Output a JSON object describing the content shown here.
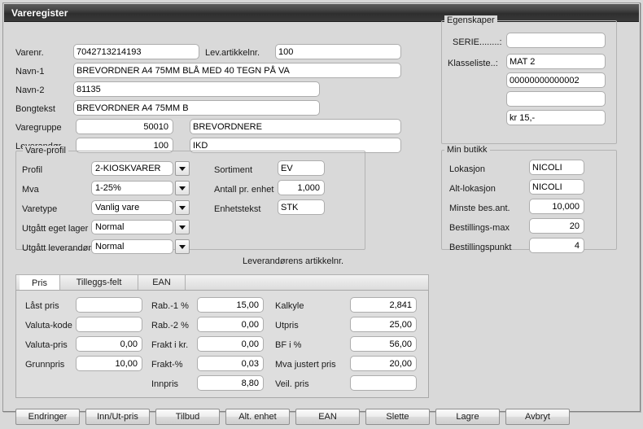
{
  "window": {
    "title": "Vareregister"
  },
  "top_fields": {
    "varenr_label": "Varenr.",
    "varenr_value": "7042713214193",
    "lev_artikkelnr_label": "Lev.artikkelnr.",
    "lev_artikkelnr_value": "100",
    "navn1_label": "Navn-1",
    "navn1_value": "BREVORDNER A4 75MM BLÅ MED 40 TEGN PÅ VA",
    "navn2_label": "Navn-2",
    "navn2_value": "81135",
    "bongtekst_label": "Bongtekst",
    "bongtekst_value": "BREVORDNER A4 75MM B",
    "varegruppe_label": "Varegruppe",
    "varegruppe_code": "50010",
    "varegruppe_name": "BREVORDNERE",
    "leverandor_label": "Leverandør",
    "leverandor_code": "100",
    "leverandor_name": "IKD"
  },
  "vareprofil": {
    "title": "Vare-profil",
    "profil_label": "Profil",
    "profil_value": "2-KIOSKVARER",
    "mva_label": "Mva",
    "mva_value": "1-25%",
    "varetype_label": "Varetype",
    "varetype_value": "Vanlig vare",
    "utgatt_eget_lager_label": "Utgått eget lager",
    "utgatt_eget_lager_value": "Normal",
    "utgatt_leverandor_label": "Utgått leverandør",
    "utgatt_leverandor_value": "Normal",
    "sortiment_label": "Sortiment",
    "sortiment_value": "EV",
    "antall_pr_enhet_label": "Antall pr. enhet",
    "antall_pr_enhet_value": "1,000",
    "enhetstekst_label": "Enhetstekst",
    "enhetstekst_value": "STK"
  },
  "hint": {
    "leverandorens_artikkelnr": "Leverandørens artikkelnr."
  },
  "egenskaper": {
    "title": "Egenskaper",
    "serie_label": "SERIE........:",
    "serie_value": "",
    "klasseliste_label": "Klasseliste..:",
    "klasseliste_values": [
      "MAT 2",
      "00000000000002",
      "",
      "kr 15,-"
    ]
  },
  "min_butikk": {
    "title": "Min butikk",
    "rows": [
      {
        "label": "Lokasjon",
        "value": "NICOLI",
        "align": "left"
      },
      {
        "label": "Alt-lokasjon",
        "value": "NICOLI",
        "align": "left"
      },
      {
        "label": "Minste bes.ant.",
        "value": "10,000",
        "align": "right"
      },
      {
        "label": "Bestillings-max",
        "value": "20",
        "align": "right"
      },
      {
        "label": "Bestillingspunkt",
        "value": "4",
        "align": "right"
      }
    ]
  },
  "tabs": {
    "items": [
      {
        "label": "Pris",
        "active": true
      },
      {
        "label": "Tilleggs-felt",
        "active": false
      },
      {
        "label": "EAN",
        "active": false
      }
    ]
  },
  "pris": {
    "col1": [
      {
        "label": "Låst pris",
        "value": "",
        "align": "left"
      },
      {
        "label": "Valuta-kode",
        "value": "",
        "align": "left"
      },
      {
        "label": "Valuta-pris",
        "value": "0,00",
        "align": "right"
      },
      {
        "label": "Grunnpris",
        "value": "10,00",
        "align": "right"
      }
    ],
    "col2": [
      {
        "label": "Rab.-1 %",
        "value": "15,00",
        "align": "right"
      },
      {
        "label": "Rab.-2 %",
        "value": "0,00",
        "align": "right"
      },
      {
        "label": "Frakt i kr.",
        "value": "0,00",
        "align": "right"
      },
      {
        "label": "Frakt-%",
        "value": "0,03",
        "align": "right"
      },
      {
        "label": "Innpris",
        "value": "8,80",
        "align": "right"
      }
    ],
    "col3": [
      {
        "label": "Kalkyle",
        "value": "2,841",
        "align": "right"
      },
      {
        "label": "Utpris",
        "value": "25,00",
        "align": "right"
      },
      {
        "label": "BF i %",
        "value": "56,00",
        "align": "right"
      },
      {
        "label": "Mva justert pris",
        "value": "20,00",
        "align": "right"
      },
      {
        "label": "Veil. pris",
        "value": "",
        "align": "right"
      }
    ]
  },
  "footer": {
    "buttons": [
      {
        "label": "Endringer"
      },
      {
        "label": "Inn/Ut-pris"
      },
      {
        "label": "Tilbud"
      },
      {
        "label": "Alt. enhet"
      },
      {
        "label": "EAN"
      },
      {
        "label": "Slette"
      },
      {
        "label": "Lagre"
      },
      {
        "label": "Avbryt"
      }
    ]
  },
  "colors": {
    "window_bg": "#d9d9d9",
    "titlebar": "#3a3a3a",
    "field_bg": "#ffffff",
    "border": "#adadad"
  }
}
